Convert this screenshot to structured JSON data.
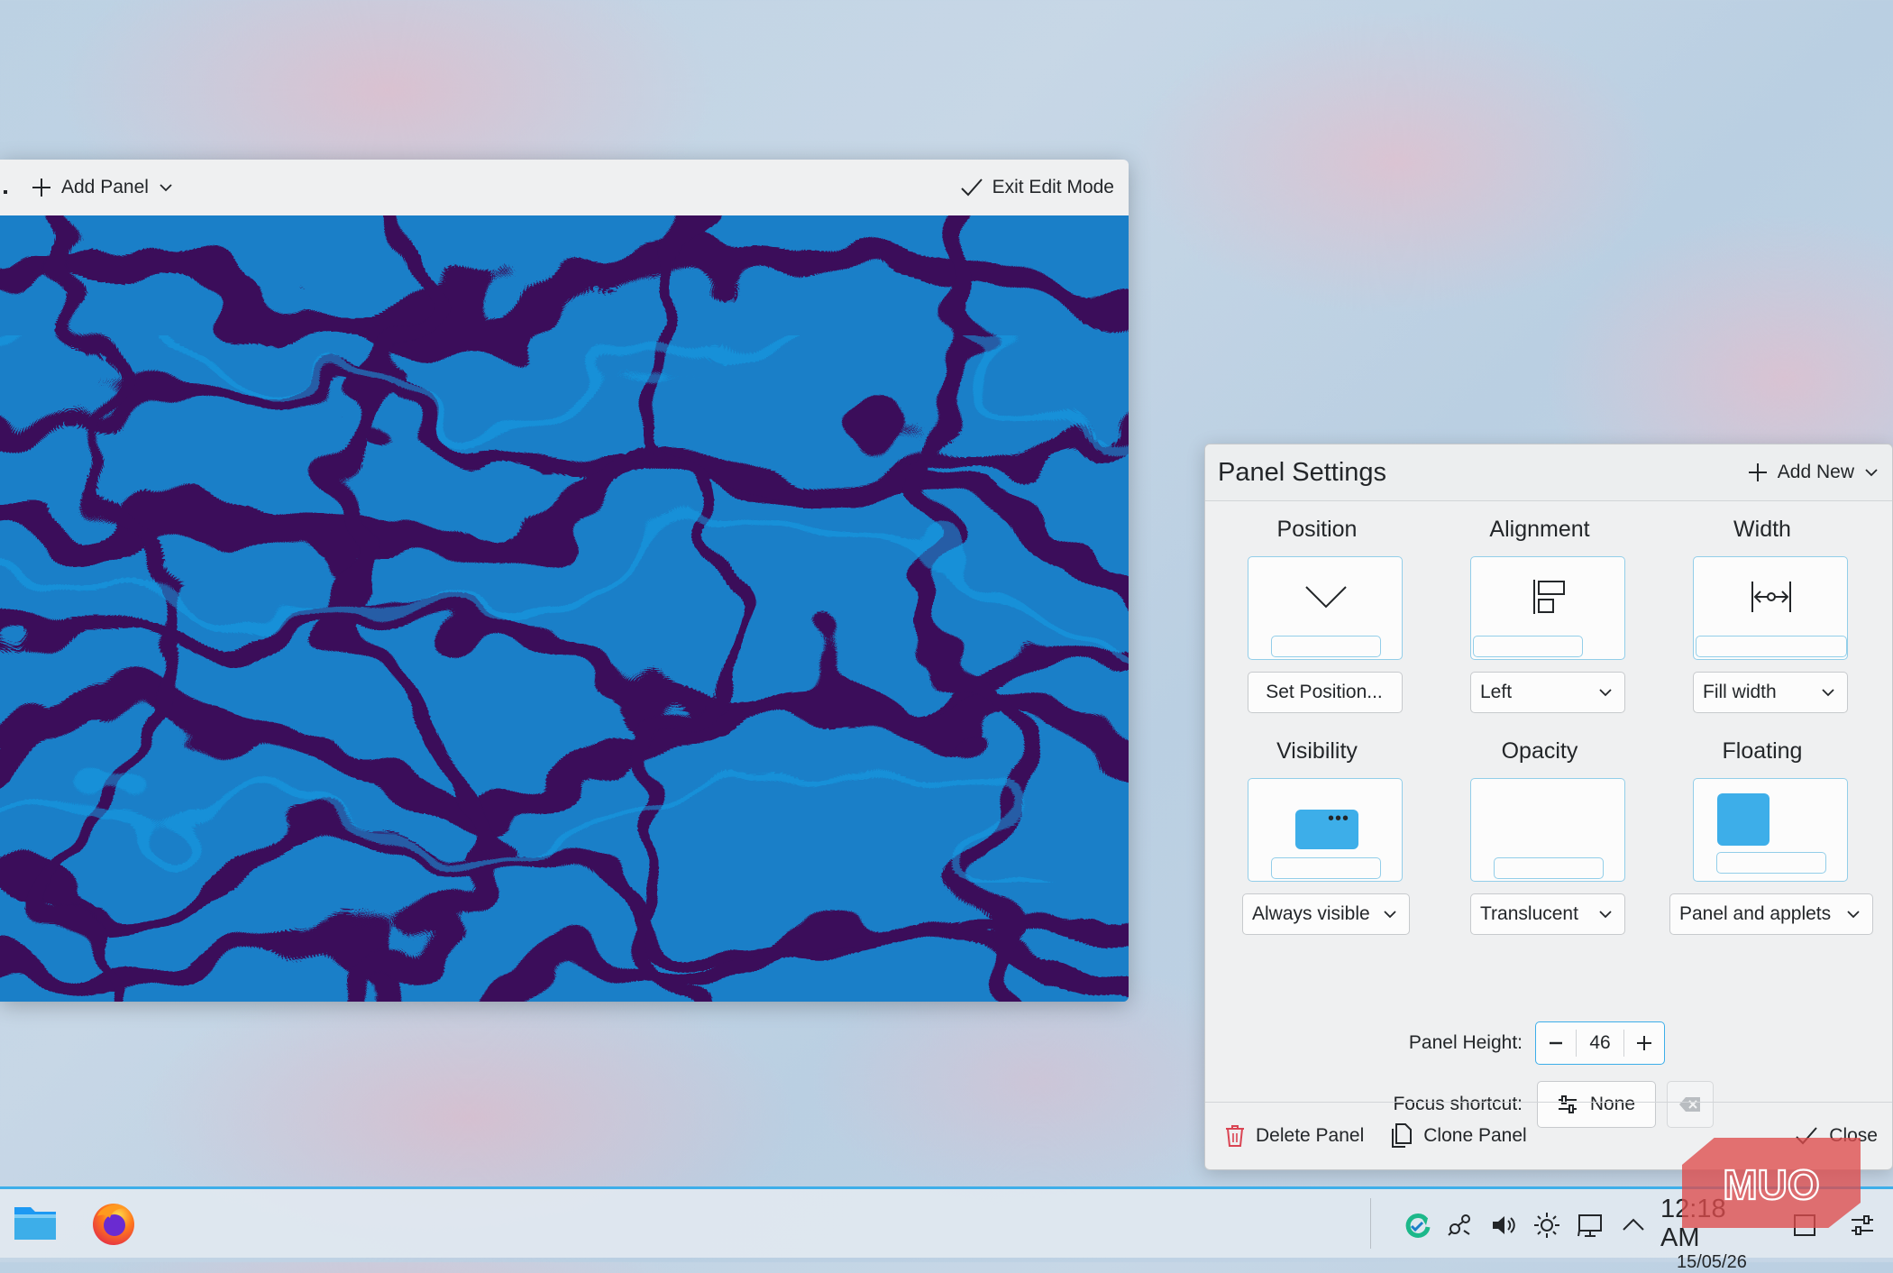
{
  "edit_toolbar": {
    "add_panel_label": "Add Panel",
    "exit_edit_label": "Exit Edit Mode"
  },
  "panel_settings": {
    "title": "Panel Settings",
    "add_new_label": "Add New",
    "position": {
      "title": "Position",
      "button_label": "Set Position..."
    },
    "alignment": {
      "title": "Alignment",
      "value": "Left"
    },
    "width": {
      "title": "Width",
      "value": "Fill width"
    },
    "visibility": {
      "title": "Visibility",
      "value": "Always visible"
    },
    "opacity": {
      "title": "Opacity",
      "value": "Translucent"
    },
    "floating": {
      "title": "Floating",
      "value": "Panel and applets"
    },
    "panel_height": {
      "label": "Panel Height:",
      "value": "46"
    },
    "focus_shortcut": {
      "label": "Focus shortcut:",
      "value": "None"
    },
    "footer": {
      "delete_label": "Delete Panel",
      "clone_label": "Clone Panel",
      "close_label": "Close"
    }
  },
  "taskbar": {
    "launchers": [
      "file-manager-icon",
      "firefox-icon"
    ],
    "tray_icons": [
      "update-notifier-icon",
      "network-icon",
      "volume-icon",
      "brightness-icon",
      "display-icon",
      "expand-tray-icon"
    ],
    "clock": {
      "time": "12:18 AM",
      "date": "15/05/26"
    }
  },
  "watermark": {
    "text": "MUO"
  },
  "colors": {
    "accent": "#3daee9",
    "delete_red": "#da4453",
    "wallpaper_blue": "#1a7fc8",
    "wallpaper_purple": "#3a0f5a"
  }
}
